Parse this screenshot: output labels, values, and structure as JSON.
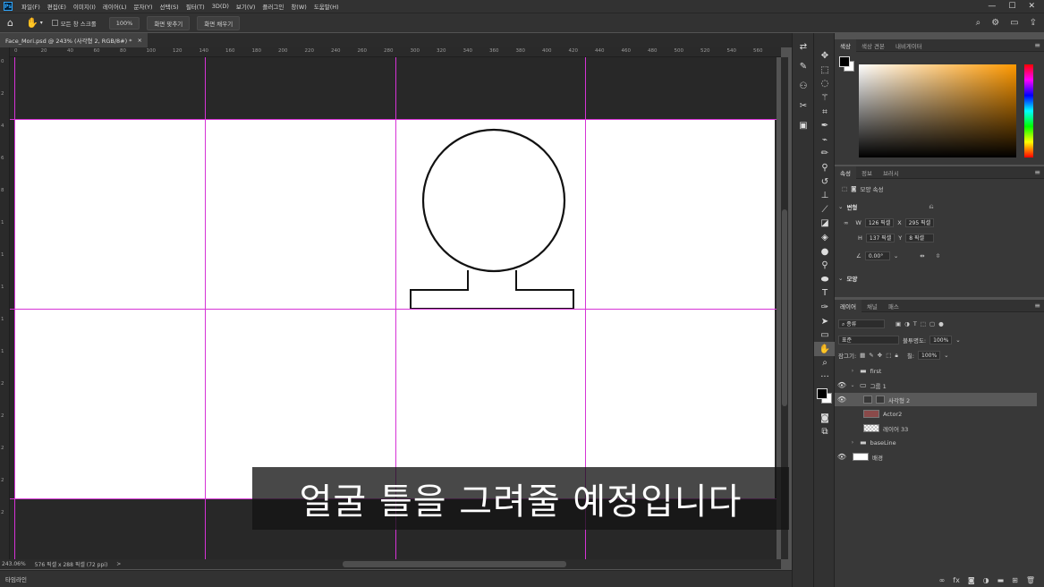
{
  "menubar": {
    "logo": "Ps",
    "items": [
      "파일(F)",
      "편집(E)",
      "이미지(I)",
      "레이어(L)",
      "문자(Y)",
      "선택(S)",
      "필터(T)",
      "3D(D)",
      "보기(V)",
      "플러그인",
      "창(W)",
      "도움말(H)"
    ],
    "minimize": "—",
    "maximize": "☐",
    "close": "✕"
  },
  "optbar": {
    "scroll_all_windows": "모든 창 스크롤",
    "zoom_value": "100%",
    "fit_screen": "화면 맞추기",
    "fill_screen": "화면 채우기"
  },
  "document": {
    "tab_title": "Face_Mori.psd @ 243% (사각형 2, RGB/8#) *",
    "tab_close": "×"
  },
  "ruler": {
    "h_ticks": [
      "0",
      "20",
      "40",
      "60",
      "80",
      "100",
      "120",
      "140",
      "160",
      "180",
      "200",
      "220",
      "240",
      "260",
      "280",
      "300",
      "320",
      "340",
      "360",
      "380",
      "400",
      "420",
      "440",
      "460",
      "480",
      "500",
      "520",
      "540",
      "560"
    ],
    "v_ticks": [
      "0",
      "2",
      "4",
      "6",
      "8",
      "1",
      "1",
      "1",
      "1",
      "1",
      "2",
      "2",
      "2",
      "2",
      "2"
    ]
  },
  "status": {
    "zoom": "243.06%",
    "doc_size": "576 픽셀 x 288 픽셀 (72 ppi)",
    "arrow": ">"
  },
  "timeline_label": "타임라인",
  "subtitle": "얼굴 틀을 그려줄 예정입니다",
  "color_panel": {
    "tabs": [
      "색상",
      "색상 견본",
      "내비게이터"
    ]
  },
  "properties_panel": {
    "tabs": [
      "속성",
      "정보",
      "브러시"
    ],
    "shape_props_label": "모양 속성",
    "transform_section": "변형",
    "w_label": "W",
    "w_value": "126 픽셀",
    "x_label": "X",
    "x_value": "295 픽셀",
    "h_label": "H",
    "h_value": "137 픽셀",
    "y_label": "Y",
    "y_value": "8 픽셀",
    "angle_value": "0.00°",
    "shape_section": "모양"
  },
  "layers_panel": {
    "tabs": [
      "레이어",
      "채널",
      "패스"
    ],
    "filter_kind": "종류",
    "blend_mode": "표준",
    "opacity_label": "불투명도:",
    "opacity_value": "100%",
    "lock_label": "잠그기:",
    "fill_label": "칠:",
    "fill_value": "100%",
    "layers": [
      {
        "name": "first",
        "type": "group",
        "visible": false,
        "indent": 0
      },
      {
        "name": "그룹 1",
        "type": "group",
        "visible": true,
        "indent": 0,
        "open": true
      },
      {
        "name": "사각형 2",
        "type": "shape",
        "visible": true,
        "indent": 1,
        "selected": true
      },
      {
        "name": "Actor2",
        "type": "image",
        "visible": false,
        "indent": 1
      },
      {
        "name": "레이어 33",
        "type": "pixel",
        "visible": false,
        "indent": 1
      },
      {
        "name": "baseLine",
        "type": "group",
        "visible": false,
        "indent": 0
      },
      {
        "name": "배경",
        "type": "background",
        "visible": true,
        "indent": 0
      }
    ]
  },
  "colors": {
    "guide": "#d633d6",
    "artboard": "#ffffff",
    "pasteboard": "#282828",
    "panel_bg": "#383838"
  }
}
